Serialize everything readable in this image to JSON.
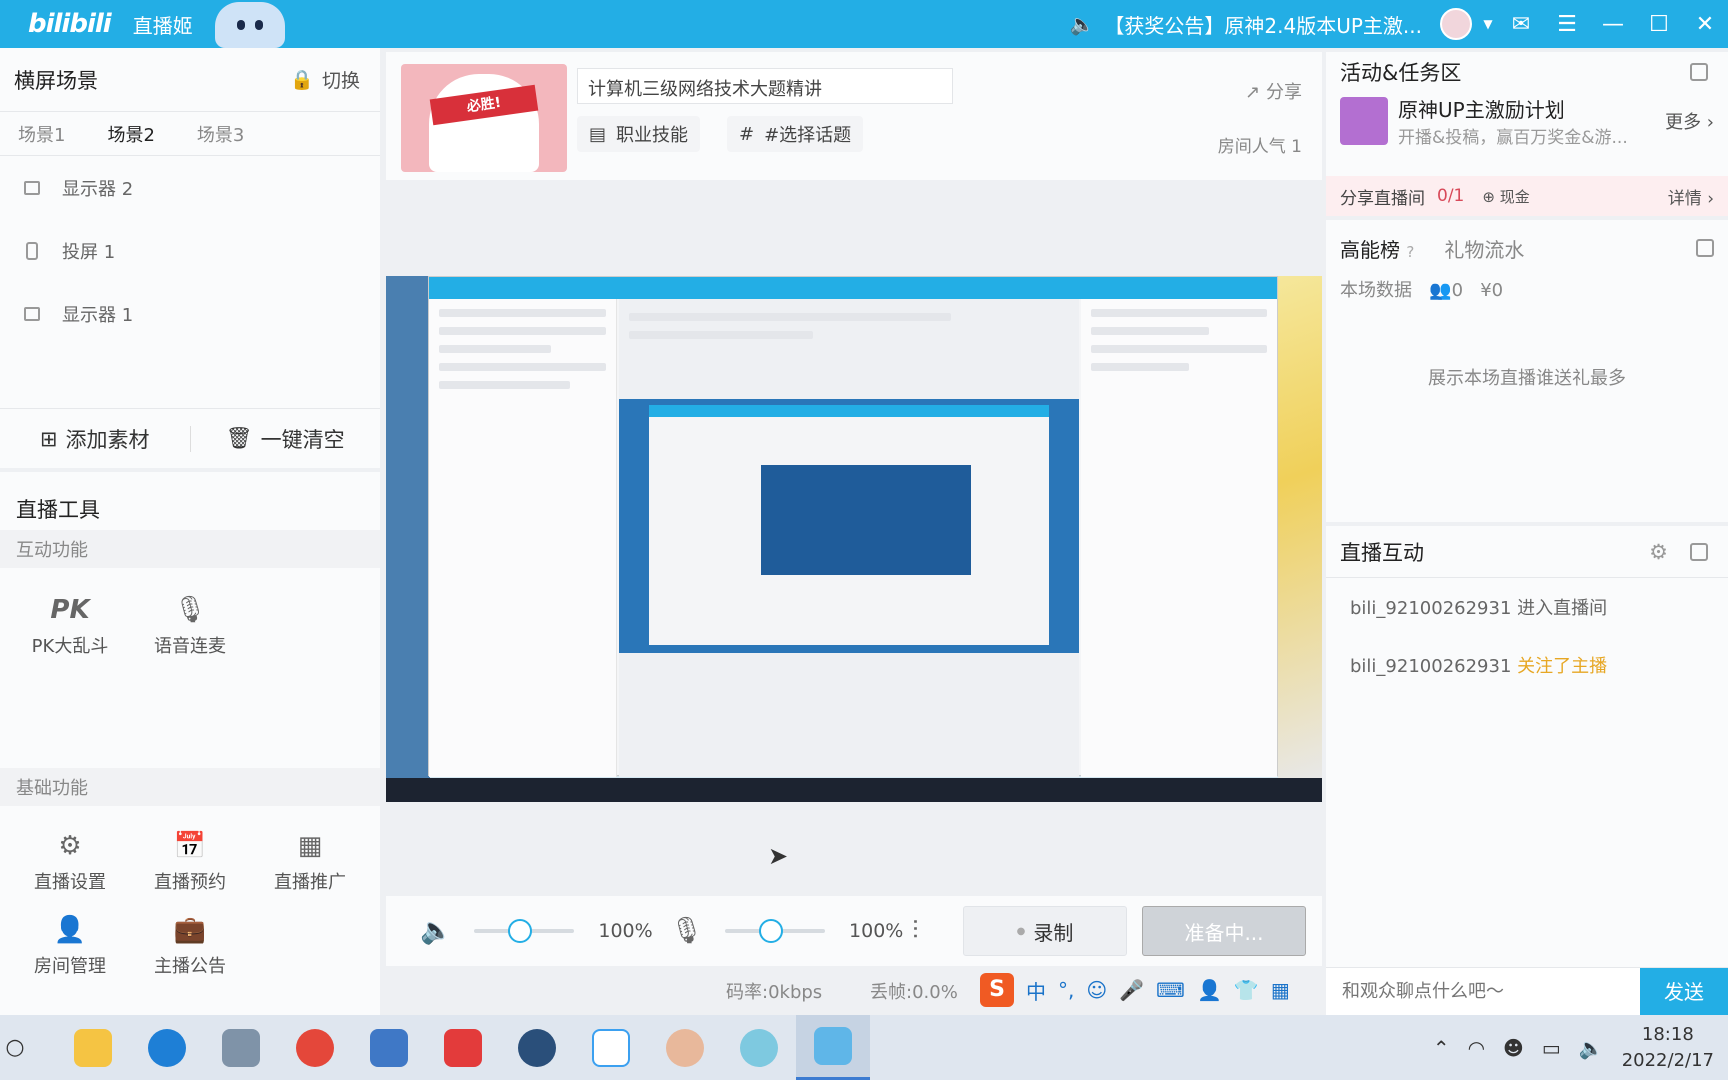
{
  "titlebar": {
    "logo": "bilibili",
    "app_name": "直播姬",
    "announcement": "【获奖公告】原神2.4版本UP主激..."
  },
  "scenes": {
    "title": "横屏场景",
    "switch_label": "切换",
    "tabs": [
      "场景1",
      "场景2",
      "场景3"
    ],
    "active_tab": "场景2",
    "sources": [
      {
        "label": "显示器 2",
        "icon": "monitor-icon"
      },
      {
        "label": "投屏 1",
        "icon": "phone-icon"
      },
      {
        "label": "显示器 1",
        "icon": "monitor-icon"
      }
    ],
    "add_label": "添加素材",
    "clear_label": "一键清空"
  },
  "tools": {
    "title": "直播工具",
    "interactive_title": "互动功能",
    "interactive": [
      {
        "label": "PK大乱斗",
        "icon": "pk-icon"
      },
      {
        "label": "语音连麦",
        "icon": "voice-link-icon"
      }
    ],
    "basic_title": "基础功能",
    "basic": [
      {
        "label": "直播设置",
        "icon": "gear-icon"
      },
      {
        "label": "直播预约",
        "icon": "calendar-icon"
      },
      {
        "label": "直播推广",
        "icon": "promote-icon"
      },
      {
        "label": "房间管理",
        "icon": "room-manage-icon"
      },
      {
        "label": "主播公告",
        "icon": "announcement-icon"
      }
    ]
  },
  "room": {
    "title": "计算机三级网络技术大题精讲",
    "category": "职业技能",
    "topic": "#选择话题",
    "share": "分享",
    "popularity": "房间人气 1",
    "cover_text": "必胜!"
  },
  "audio": {
    "speaker_volume": "100%",
    "mic_volume": "100%",
    "record_label": "录制",
    "ready_label": "准备中..."
  },
  "status": {
    "bitrate": "码率:0kbps",
    "dropped": "丢帧:0.0%"
  },
  "ime": {
    "logo": "S",
    "mode": "中",
    "punct": "°,"
  },
  "activity": {
    "title": "活动&任务区",
    "task_title": "原神UP主激励计划",
    "task_desc": "开播&投稿，赢百万奖金&游...",
    "more": "更多",
    "share_room": "分享直播间",
    "share_count": "0/1",
    "cash": "现金",
    "details": "详情"
  },
  "rank": {
    "tab_active": "高能榜",
    "tab_other": "礼物流水",
    "session_label": "本场数据",
    "people": "0",
    "money": "¥0",
    "empty": "展示本场直播谁送礼最多"
  },
  "chat": {
    "title": "直播互动",
    "messages": [
      {
        "user": "bili_92100262931",
        "action": "进入直播间"
      },
      {
        "user": "bili_92100262931",
        "action": "关注了主播"
      }
    ],
    "placeholder": "和观众聊点什么吧～",
    "send": "发送"
  },
  "taskbar": {
    "time": "18:18",
    "date": "2022/2/17"
  },
  "colors": {
    "brand": "#23aee5",
    "highlight": "#e7a724",
    "danger": "#d84a5a"
  }
}
